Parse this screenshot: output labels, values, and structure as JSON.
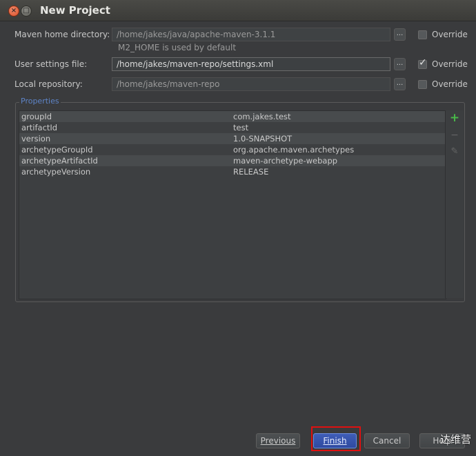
{
  "window": {
    "title": "New Project",
    "close_glyph": "×",
    "maximize_glyph": "□"
  },
  "form": {
    "maven_home": {
      "label": "Maven home directory:",
      "value": "/home/jakes/java/apache-maven-3.1.1",
      "hint": "M2_HOME is used by default",
      "override_label": "Override",
      "override_checked": false
    },
    "user_settings": {
      "label": "User settings file:",
      "value": "/home/jakes/maven-repo/settings.xml",
      "override_label": "Override",
      "override_checked": true
    },
    "local_repository": {
      "label": "Local repository:",
      "value": "/home/jakes/maven-repo",
      "override_label": "Override",
      "override_checked": false
    },
    "browse_label": "..."
  },
  "properties": {
    "title": "Properties",
    "rows": [
      {
        "key": "groupId",
        "value": "com.jakes.test"
      },
      {
        "key": "artifactId",
        "value": "test"
      },
      {
        "key": "version",
        "value": "1.0-SNAPSHOT"
      },
      {
        "key": "archetypeGroupId",
        "value": "org.apache.maven.archetypes"
      },
      {
        "key": "archetypeArtifactId",
        "value": "maven-archetype-webapp"
      },
      {
        "key": "archetypeVersion",
        "value": "RELEASE"
      }
    ],
    "toolbar": {
      "add": "+",
      "remove": "−",
      "edit": "✎"
    }
  },
  "buttons": {
    "previous": "Previous",
    "finish": "Finish",
    "cancel": "Cancel",
    "help": "Help"
  },
  "watermark": "达维营",
  "colors": {
    "highlight": "#e01010",
    "finish_button": "#3f5db8",
    "group_title": "#5e84c8"
  }
}
